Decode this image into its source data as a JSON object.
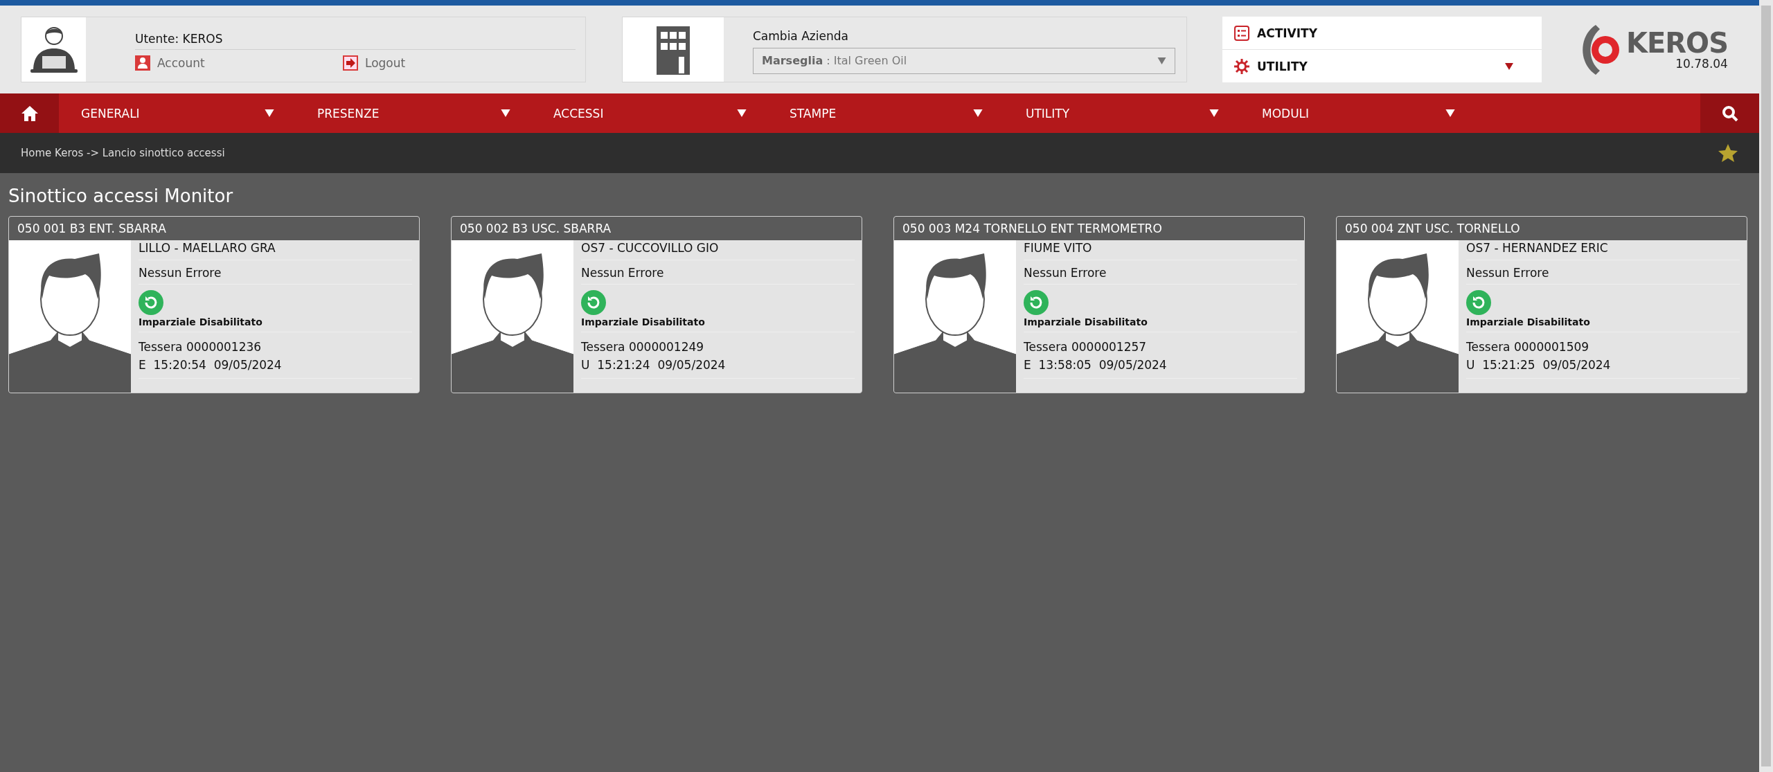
{
  "user": {
    "label": "Utente: KEROS",
    "links": [
      {
        "kind": "account",
        "label": "Account"
      },
      {
        "kind": "logout",
        "label": "Logout"
      }
    ]
  },
  "company": {
    "label": "Cambia Azienda",
    "value": "**Marseglia** : Ital Green Oil"
  },
  "quick_menu": [
    {
      "kind": "activity",
      "label": "ACTIVITY",
      "dropdown": false
    },
    {
      "kind": "utility",
      "label": "UTILITY",
      "dropdown": true
    }
  ],
  "logo": {
    "text": "KEROS",
    "version": "10.78.04"
  },
  "nav": [
    {
      "label": "GENERALI"
    },
    {
      "label": "PRESENZE"
    },
    {
      "label": "ACCESSI"
    },
    {
      "label": "STAMPE"
    },
    {
      "label": "UTILITY"
    },
    {
      "label": "MODULI"
    }
  ],
  "breadcrumb": "Home Keros -> Lancio sinottico accessi",
  "page_title": "Sinottico accessi Monitor",
  "terminals": [
    {
      "title": "050 001 B3 ENT. SBARRA",
      "person": "LILLO - MAELLARO GRA",
      "status": "Nessun Errore",
      "mode": "Imparziale Disabilitato",
      "card": "Tessera 0000001236",
      "event": "E  15:20:54  09/05/2024"
    },
    {
      "title": "050 002 B3 USC. SBARRA",
      "person": "OS7 - CUCCOVILLO GIO",
      "status": "Nessun Errore",
      "mode": "Imparziale Disabilitato",
      "card": "Tessera 0000001249",
      "event": "U  15:21:24  09/05/2024"
    },
    {
      "title": "050 003 M24 TORNELLO ENT TERMOMETRO",
      "person": "FIUME VITO",
      "status": "Nessun Errore",
      "mode": "Imparziale Disabilitato",
      "card": "Tessera 0000001257",
      "event": "E  13:58:05  09/05/2024"
    },
    {
      "title": "050 004 ZNT USC. TORNELLO",
      "person": "OS7 - HERNANDEZ ERIC",
      "status": "Nessun Errore",
      "mode": "Imparziale Disabilitato",
      "card": "Tessera 0000001509",
      "event": "U  15:21:25  09/05/2024"
    }
  ]
}
